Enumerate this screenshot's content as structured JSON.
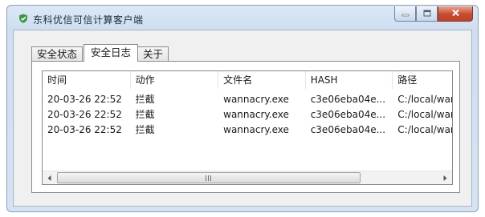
{
  "window": {
    "title": "东科优信可信计算客户端",
    "colors": {
      "accent": "#3a9a3f",
      "close": "#c84a2e",
      "frame": "#cfdff1"
    },
    "icon": "shield-icon",
    "controls": {
      "minimize": "minimize-icon",
      "maximize": "maximize-icon",
      "close": "close-icon"
    }
  },
  "tabs": [
    {
      "label": "安全状态"
    },
    {
      "label": "安全日志"
    },
    {
      "label": "关于"
    }
  ],
  "active_tab": "安全日志",
  "log_table": {
    "columns": [
      "时间",
      "动作",
      "文件名",
      "HASH",
      "路径"
    ],
    "rows": [
      [
        "20-03-26 22:52",
        "拦截",
        "wannacry.exe",
        "c3e06eba04e...",
        "C:/local/wanna"
      ],
      [
        "20-03-26 22:52",
        "拦截",
        "wannacry.exe",
        "c3e06eba04e...",
        "C:/local/wanna"
      ],
      [
        "20-03-26 22:52",
        "拦截",
        "wannacry.exe",
        "c3e06eba04e...",
        "C:/local/wanna"
      ]
    ]
  },
  "scrollbar": {
    "thumb_grip": "|||"
  }
}
